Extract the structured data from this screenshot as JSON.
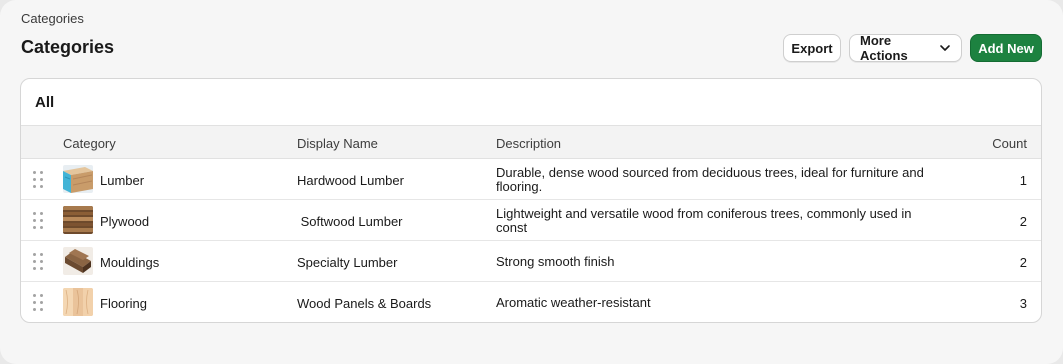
{
  "breadcrumb": "Categories",
  "page_title": "Categories",
  "actions": {
    "export": "Export",
    "more": "More Actions",
    "add": "Add New"
  },
  "colors": {
    "primary": "#1d8240",
    "border": "#d6d6d6",
    "header_bg": "#f3f3f3"
  },
  "tab": "All",
  "columns": {
    "category": "Category",
    "display_name": "Display Name",
    "description": "Description",
    "count": "Count"
  },
  "rows": [
    {
      "category": "Lumber",
      "display_name": "Hardwood Lumber",
      "description": "Durable, dense wood sourced from deciduous trees, ideal for furniture and flooring.",
      "count": "1",
      "icon": "lumber-thumbnail-icon"
    },
    {
      "category": "Plywood",
      "display_name": " Softwood Lumber",
      "description": "Lightweight and versatile wood from coniferous trees, commonly used in const",
      "count": "2",
      "icon": "plywood-thumbnail-icon"
    },
    {
      "category": "Mouldings",
      "display_name": "Specialty Lumber",
      "description": "Strong smooth finish",
      "count": "2",
      "icon": "mouldings-thumbnail-icon"
    },
    {
      "category": "Flooring",
      "display_name": "Wood Panels & Boards",
      "description": "Aromatic weather-resistant",
      "count": "3",
      "icon": "flooring-thumbnail-icon"
    }
  ]
}
